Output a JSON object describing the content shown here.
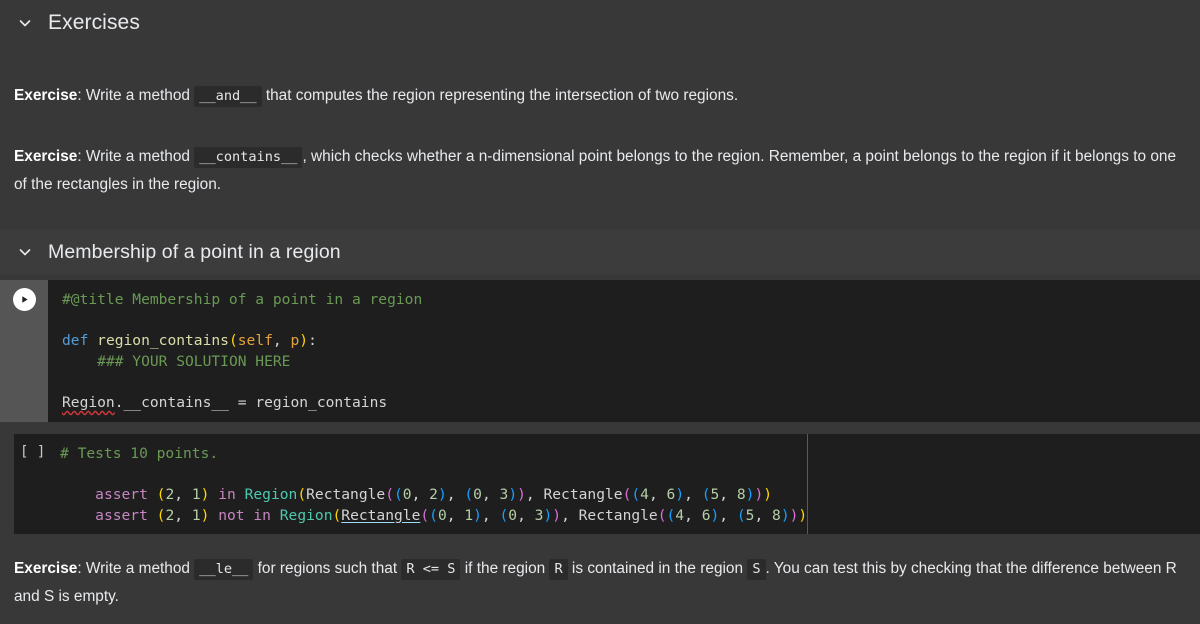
{
  "document": {
    "background": "#383838",
    "code_background": "#1e1e1e",
    "header_background": "#3c3c3c",
    "gutter_background": "#555555"
  },
  "sections": {
    "exercises": {
      "title": "Exercises",
      "chevron": "chevron-down-icon",
      "expanded": true
    },
    "membership": {
      "title": "Membership of a point in a region",
      "chevron": "chevron-down-icon",
      "expanded": true
    }
  },
  "exercise_and": {
    "label": "Exercise",
    "colon": ": ",
    "text_before": "Write a method ",
    "code": "__and__",
    "text_after": " that computes the region representing the intersection of two regions."
  },
  "exercise_contains": {
    "label": "Exercise",
    "colon": ": ",
    "text_before": "Write a method ",
    "code": "__contains__",
    "text_after": ", which checks whether a n-dimensional point belongs to the region. Remember, a point belongs to the region if it belongs to one of the rectangles in the region."
  },
  "code_cell_1": {
    "run_button": "play-icon",
    "execution_count": "",
    "lines": {
      "l1_comment": "#@title Membership of a point in a region",
      "l2": "",
      "l3_kw": "def",
      "l3_fn": " region_contains",
      "l3_sig": "(self, p):",
      "l4_comment": "    ### YOUR SOLUTION HERE",
      "l5": "",
      "l6": "Region.__contains__ = region_contains"
    },
    "raw": "#@title Membership of a point in a region\n\ndef region_contains(self, p):\n    ### YOUR SOLUTION HERE\n\nRegion.__contains__ = region_contains"
  },
  "code_cell_2": {
    "execution_indicator": "[ ]",
    "comment": "# Tests 10 points.",
    "assert_1": "assert (2, 1) in Region(Rectangle((0, 2), (0, 3)), Rectangle((4, 6), (5, 8)))",
    "assert_2": "assert (2, 1) not in Region(Rectangle((0, 1), (0, 3)), Rectangle((4, 6), (5, 8)))",
    "tokens": {
      "kw_assert": "assert",
      "kw_in": "in",
      "kw_not": "not",
      "cls_region": "Region",
      "cls_rectangle": "Rectangle",
      "point": "(2, 1)"
    },
    "ruler_column": 80,
    "raw": "# Tests 10 points.\n\nassert (2, 1) in Region(Rectangle((0, 2), (0, 3)), Rectangle((4, 6), (5, 8)))\nassert (2, 1) not in Region(Rectangle((0, 1), (0, 3)), Rectangle((4, 6), (5, 8)))"
  },
  "exercise_le": {
    "label": "Exercise",
    "colon": ": ",
    "t1": "Write a method ",
    "c1": "__le__",
    "t2": " for regions such that ",
    "c2": "R <= S",
    "t3": " if the region ",
    "c3": "R",
    "t4": " is contained in the region ",
    "c4": "S",
    "t5": ". You can test this by checking that the difference between R and S is empty."
  }
}
